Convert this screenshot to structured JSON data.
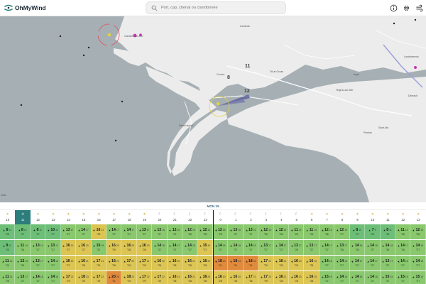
{
  "app": {
    "name": "OhMyWind",
    "brand_color": "#1d2b36",
    "accent_color": "#2c7d7c"
  },
  "search": {
    "placeholder": "Port, cap, chenal ou coordonnée"
  },
  "header_icons": [
    "info-icon",
    "gear-icon",
    "wind-icon"
  ],
  "map": {
    "place_labels": [
      "Landéda",
      "Crozon",
      "Saint-Hernot",
      "Argol",
      "Telgruc-sur-Mer",
      "Dinéault",
      "Pentrez",
      "Saint-Nic",
      "Landévennec",
      "Tal ar Groas",
      "Camaret-sur-Mer"
    ],
    "grid_numbers": [
      "8",
      "11",
      "12"
    ],
    "edge_label": "ernto"
  },
  "timeline": {
    "date": "MON 15",
    "selected_hour_index": 1,
    "hours": [
      {
        "h": "10",
        "icon": "sun"
      },
      {
        "h": "11",
        "icon": "sun"
      },
      {
        "h": "12",
        "icon": "sun"
      },
      {
        "h": "13",
        "icon": "sun"
      },
      {
        "h": "14",
        "icon": "sun"
      },
      {
        "h": "15",
        "icon": "sun"
      },
      {
        "h": "16",
        "icon": "sun"
      },
      {
        "h": "17",
        "icon": "sun"
      },
      {
        "h": "18",
        "icon": "sun"
      },
      {
        "h": "19",
        "icon": "sun"
      },
      {
        "h": "20",
        "icon": "moon"
      },
      {
        "h": "21",
        "icon": "moon"
      },
      {
        "h": "22",
        "icon": "moon"
      },
      {
        "h": "23",
        "icon": "moon"
      },
      {
        "h": "0",
        "icon": "moon"
      },
      {
        "h": "1",
        "icon": "moon"
      },
      {
        "h": "2",
        "icon": "moon"
      },
      {
        "h": "3",
        "icon": "moon"
      },
      {
        "h": "4",
        "icon": "moon"
      },
      {
        "h": "5",
        "icon": "moon"
      },
      {
        "h": "6",
        "icon": "sun"
      },
      {
        "h": "7",
        "icon": "sun"
      },
      {
        "h": "8",
        "icon": "sun"
      },
      {
        "h": "9",
        "icon": "sun"
      },
      {
        "h": "10",
        "icon": "sun"
      },
      {
        "h": "11",
        "icon": "sun"
      },
      {
        "h": "12",
        "icon": "sun"
      },
      {
        "h": "13",
        "icon": "sun"
      }
    ],
    "rows": [
      [
        {
          "v": "8",
          "g": "11",
          "t": "25",
          "c": "#6dbf78"
        },
        {
          "v": "8",
          "g": "12",
          "t": "27",
          "c": "#6dbf78"
        },
        {
          "v": "8",
          "g": "11",
          "t": "27",
          "c": "#6dbf78"
        },
        {
          "v": "10",
          "g": "14",
          "t": "27",
          "c": "#6dbf78"
        },
        {
          "v": "13",
          "g": "17",
          "t": "27",
          "c": "#89c86d"
        },
        {
          "v": "14",
          "g": "17",
          "t": "27",
          "c": "#89c86d"
        },
        {
          "v": "16",
          "g": "21",
          "t": "29",
          "c": "#dcc552"
        },
        {
          "v": "14",
          "g": "17",
          "t": "27",
          "c": "#89c86d"
        },
        {
          "v": "14",
          "g": "17",
          "t": "27",
          "c": "#89c86d"
        },
        {
          "v": "13",
          "g": "17",
          "t": "27",
          "c": "#89c86d"
        },
        {
          "v": "13",
          "g": "16",
          "t": "27",
          "c": "#89c86d"
        },
        {
          "v": "12",
          "g": "15",
          "t": "27",
          "c": "#89c86d"
        },
        {
          "v": "12",
          "g": "15",
          "t": "26",
          "c": "#89c86d"
        },
        {
          "v": "12",
          "g": "15",
          "t": "26",
          "c": "#89c86d"
        },
        {
          "v": "12",
          "g": "15",
          "t": "26",
          "c": "#89c86d"
        },
        {
          "v": "13",
          "g": "16",
          "t": "27",
          "c": "#89c86d"
        },
        {
          "v": "13",
          "g": "16",
          "t": "27",
          "c": "#89c86d"
        },
        {
          "v": "12",
          "g": "15",
          "t": "26",
          "c": "#89c86d"
        },
        {
          "v": "12",
          "g": "16",
          "t": "26",
          "c": "#89c86d"
        },
        {
          "v": "11",
          "g": "14",
          "t": "26",
          "c": "#89c86d"
        },
        {
          "v": "11",
          "g": "14",
          "t": "26",
          "c": "#89c86d"
        },
        {
          "v": "12",
          "g": "15",
          "t": "26",
          "c": "#89c86d"
        },
        {
          "v": "12",
          "g": "15",
          "t": "27",
          "c": "#89c86d"
        },
        {
          "v": "8",
          "g": "11",
          "t": "27",
          "c": "#6dbf78"
        },
        {
          "v": "7",
          "g": "9",
          "t": "26",
          "c": "#6dbf78"
        },
        {
          "v": "8",
          "g": "11",
          "t": "26",
          "c": "#6dbf78"
        },
        {
          "v": "11",
          "g": "14",
          "t": "26",
          "c": "#89c86d"
        },
        {
          "v": "12",
          "g": "15",
          "t": "26",
          "c": "#89c86d"
        }
      ],
      [
        {
          "v": "9",
          "g": "12",
          "t": "25",
          "c": "#6dbf78"
        },
        {
          "v": "11",
          "g": "14",
          "t": "26",
          "c": "#89c86d"
        },
        {
          "v": "13",
          "g": "16",
          "t": "27",
          "c": "#89c86d"
        },
        {
          "v": "13",
          "g": "17",
          "t": "27",
          "c": "#89c86d"
        },
        {
          "v": "16",
          "g": "20",
          "t": "27",
          "c": "#dcc552"
        },
        {
          "v": "16",
          "g": "20",
          "t": "27",
          "c": "#dcc552"
        },
        {
          "v": "15",
          "g": "19",
          "t": "27",
          "c": "#89c86d"
        },
        {
          "v": "16",
          "g": "20",
          "t": "29",
          "c": "#dcc552"
        },
        {
          "v": "16",
          "g": "20",
          "t": "28",
          "c": "#dcc552"
        },
        {
          "v": "16",
          "g": "20",
          "t": "28",
          "c": "#dcc552"
        },
        {
          "v": "14",
          "g": "18",
          "t": "27",
          "c": "#89c86d"
        },
        {
          "v": "14",
          "g": "17",
          "t": "27",
          "c": "#89c86d"
        },
        {
          "v": "14",
          "g": "18",
          "t": "27",
          "c": "#89c86d"
        },
        {
          "v": "15",
          "g": "19",
          "t": "27",
          "c": "#dcc552"
        },
        {
          "v": "14",
          "g": "18",
          "t": "27",
          "c": "#89c86d"
        },
        {
          "v": "14",
          "g": "18",
          "t": "27",
          "c": "#89c86d"
        },
        {
          "v": "14",
          "g": "18",
          "t": "27",
          "c": "#89c86d"
        },
        {
          "v": "13",
          "g": "17",
          "t": "27",
          "c": "#89c86d"
        },
        {
          "v": "14",
          "g": "17",
          "t": "27",
          "c": "#89c86d"
        },
        {
          "v": "13",
          "g": "17",
          "t": "26",
          "c": "#89c86d"
        },
        {
          "v": "13",
          "g": "17",
          "t": "27",
          "c": "#89c86d"
        },
        {
          "v": "14",
          "g": "17",
          "t": "27",
          "c": "#89c86d"
        },
        {
          "v": "13",
          "g": "17",
          "t": "26",
          "c": "#89c86d"
        },
        {
          "v": "14",
          "g": "18",
          "t": "26",
          "c": "#89c86d"
        },
        {
          "v": "14",
          "g": "18",
          "t": "27",
          "c": "#89c86d"
        },
        {
          "v": "14",
          "g": "18",
          "t": "26",
          "c": "#89c86d"
        },
        {
          "v": "14",
          "g": "17",
          "t": "26",
          "c": "#89c86d"
        },
        {
          "v": "14",
          "g": "18",
          "t": "27",
          "c": "#89c86d"
        }
      ],
      [
        {
          "v": "11",
          "g": "14",
          "t": "25",
          "c": "#89c86d"
        },
        {
          "v": "12",
          "g": "15",
          "t": "26",
          "c": "#89c86d"
        },
        {
          "v": "13",
          "g": "17",
          "t": "27",
          "c": "#89c86d"
        },
        {
          "v": "14",
          "g": "18",
          "t": "27",
          "c": "#89c86d"
        },
        {
          "v": "16",
          "g": "20",
          "t": "27",
          "c": "#dcc552"
        },
        {
          "v": "16",
          "g": "21",
          "t": "28",
          "c": "#dcc552"
        },
        {
          "v": "17",
          "g": "21",
          "t": "29",
          "c": "#dcc552"
        },
        {
          "v": "16",
          "g": "21",
          "t": "28",
          "c": "#dcc552"
        },
        {
          "v": "17",
          "g": "22",
          "t": "29",
          "c": "#dcc552"
        },
        {
          "v": "17",
          "g": "21",
          "t": "28",
          "c": "#dcc552"
        },
        {
          "v": "16",
          "g": "20",
          "t": "28",
          "c": "#dcc552"
        },
        {
          "v": "16",
          "g": "20",
          "t": "28",
          "c": "#dcc552"
        },
        {
          "v": "16",
          "g": "21",
          "t": "28",
          "c": "#dcc552"
        },
        {
          "v": "16",
          "g": "20",
          "t": "28",
          "c": "#dcc552"
        },
        {
          "v": "18",
          "g": "23",
          "t": "31",
          "c": "#e08a3c"
        },
        {
          "v": "18",
          "g": "23",
          "t": "31",
          "c": "#e08a3c"
        },
        {
          "v": "18",
          "g": "23",
          "t": "31",
          "c": "#e08a3c"
        },
        {
          "v": "17",
          "g": "22",
          "t": "29",
          "c": "#dcc552"
        },
        {
          "v": "16",
          "g": "21",
          "t": "28",
          "c": "#dcc552"
        },
        {
          "v": "16",
          "g": "20",
          "t": "28",
          "c": "#dcc552"
        },
        {
          "v": "16",
          "g": "20",
          "t": "28",
          "c": "#dcc552"
        },
        {
          "v": "14",
          "g": "18",
          "t": "27",
          "c": "#89c86d"
        },
        {
          "v": "14",
          "g": "18",
          "t": "27",
          "c": "#89c86d"
        },
        {
          "v": "14",
          "g": "17",
          "t": "27",
          "c": "#89c86d"
        },
        {
          "v": "14",
          "g": "17",
          "t": "27",
          "c": "#89c86d"
        },
        {
          "v": "13",
          "g": "17",
          "t": "27",
          "c": "#89c86d"
        },
        {
          "v": "14",
          "g": "18",
          "t": "27",
          "c": "#89c86d"
        },
        {
          "v": "14",
          "g": "18",
          "t": "27",
          "c": "#89c86d"
        }
      ],
      [
        {
          "v": "11",
          "g": "14",
          "t": "26",
          "c": "#89c86d"
        },
        {
          "v": "13",
          "g": "17",
          "t": "27",
          "c": "#89c86d"
        },
        {
          "v": "14",
          "g": "18",
          "t": "27",
          "c": "#89c86d"
        },
        {
          "v": "14",
          "g": "18",
          "t": "27",
          "c": "#89c86d"
        },
        {
          "v": "17",
          "g": "22",
          "t": "29",
          "c": "#dcc552"
        },
        {
          "v": "18",
          "g": "23",
          "t": "29",
          "c": "#dcc552"
        },
        {
          "v": "17",
          "g": "22",
          "t": "29",
          "c": "#dcc552"
        },
        {
          "v": "20",
          "g": "25",
          "t": "31",
          "c": "#e08a3c"
        },
        {
          "v": "18",
          "g": "23",
          "t": "29",
          "c": "#dcc552"
        },
        {
          "v": "17",
          "g": "22",
          "t": "29",
          "c": "#dcc552"
        },
        {
          "v": "17",
          "g": "22",
          "t": "29",
          "c": "#dcc552"
        },
        {
          "v": "16",
          "g": "21",
          "t": "28",
          "c": "#dcc552"
        },
        {
          "v": "16",
          "g": "21",
          "t": "28",
          "c": "#dcc552"
        },
        {
          "v": "16",
          "g": "20",
          "t": "28",
          "c": "#dcc552"
        },
        {
          "v": "16",
          "g": "20",
          "t": "28",
          "c": "#dcc552"
        },
        {
          "v": "16",
          "g": "20",
          "t": "28",
          "c": "#dcc552"
        },
        {
          "v": "17",
          "g": "21",
          "t": "28",
          "c": "#dcc552"
        },
        {
          "v": "17",
          "g": "22",
          "t": "29",
          "c": "#dcc552"
        },
        {
          "v": "16",
          "g": "21",
          "t": "28",
          "c": "#dcc552"
        },
        {
          "v": "16",
          "g": "20",
          "t": "28",
          "c": "#dcc552"
        },
        {
          "v": "16",
          "g": "20",
          "t": "28",
          "c": "#dcc552"
        },
        {
          "v": "15",
          "g": "19",
          "t": "27",
          "c": "#89c86d"
        },
        {
          "v": "14",
          "g": "18",
          "t": "27",
          "c": "#89c86d"
        },
        {
          "v": "14",
          "g": "18",
          "t": "27",
          "c": "#89c86d"
        },
        {
          "v": "14",
          "g": "18",
          "t": "27",
          "c": "#89c86d"
        },
        {
          "v": "15",
          "g": "19",
          "t": "27",
          "c": "#89c86d"
        },
        {
          "v": "15",
          "g": "19",
          "t": "27",
          "c": "#89c86d"
        },
        {
          "v": "15",
          "g": "19",
          "t": "27",
          "c": "#89c86d"
        }
      ]
    ]
  }
}
